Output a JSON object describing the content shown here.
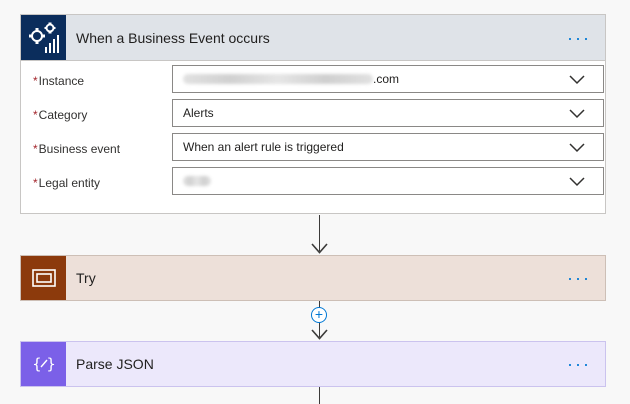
{
  "trigger": {
    "title": "When a Business Event occurs",
    "more_label": "···",
    "fields": [
      {
        "label": "Instance",
        "required": "*",
        "value": ".com"
      },
      {
        "label": "Category",
        "required": "*",
        "value": "Alerts"
      },
      {
        "label": "Business event",
        "required": "*",
        "value": "When an alert rule is triggered"
      },
      {
        "label": "Legal entity",
        "required": "*",
        "value": ""
      }
    ]
  },
  "try_step": {
    "title": "Try",
    "more_label": "···"
  },
  "parse_step": {
    "title": "Parse JSON",
    "more_label": "···"
  },
  "add_step_label": "+",
  "colors": {
    "trigger_icon_bg": "#0b2d5c",
    "try_icon_bg": "#8c3a0c",
    "parse_icon_bg": "#7b60e8",
    "link_blue": "#0078d4"
  },
  "icons": {
    "trigger": "gears-chart-icon",
    "try": "scope-icon",
    "parse": "curly-braces-icon",
    "dropdown": "chevron-down-icon",
    "add": "plus-circle-icon"
  }
}
